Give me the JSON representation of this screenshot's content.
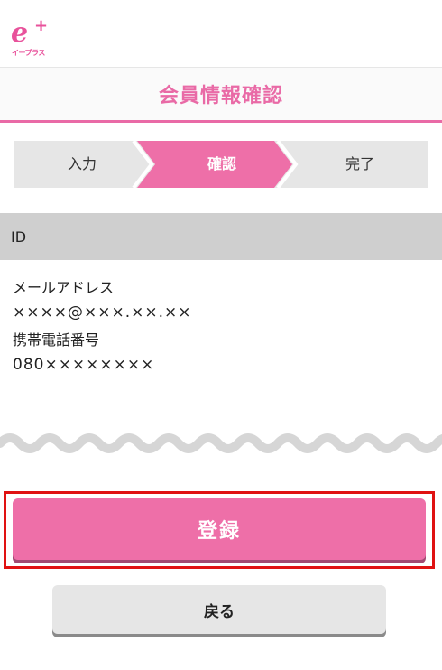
{
  "header": {
    "logo_mark": "e",
    "logo_plus": "+",
    "logo_sub": "イープラス"
  },
  "page": {
    "title": "会員情報確認"
  },
  "steps": [
    {
      "label": "入力",
      "state": "done"
    },
    {
      "label": "確認",
      "state": "current"
    },
    {
      "label": "完了",
      "state": "pending"
    }
  ],
  "id_section": {
    "label": "ID"
  },
  "info": {
    "email_label": "メールアドレス",
    "email_value": "××××@×××.××.××",
    "phone_label": "携帯電話番号",
    "phone_value": "080××××××××"
  },
  "actions": {
    "register_label": "登録",
    "back_label": "戻る"
  },
  "colors": {
    "brand_pink": "#e96aa6",
    "button_pink": "#ee6fa8",
    "highlight_red": "#e01212",
    "step_gray": "#e6e6e6"
  }
}
